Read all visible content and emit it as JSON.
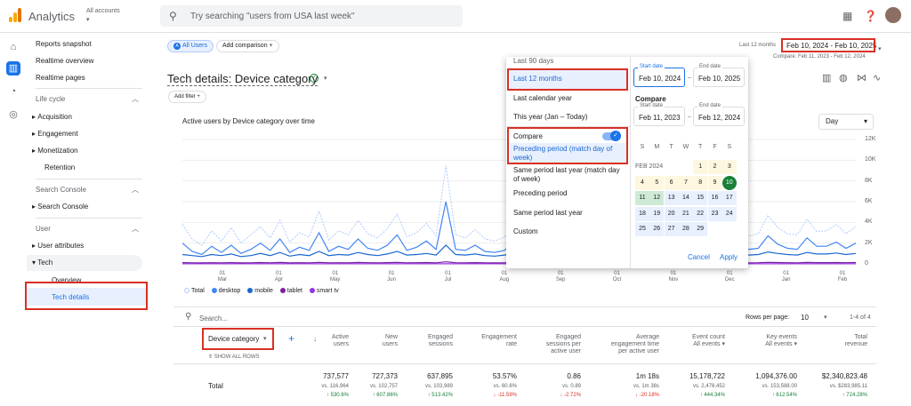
{
  "app": {
    "name": "Analytics",
    "account_label": "All accounts",
    "account_caret": "▾"
  },
  "search": {
    "placeholder": "Try searching \"users from USA last week\""
  },
  "nav": {
    "items": [
      "Reports snapshot",
      "Realtime overview",
      "Realtime pages"
    ],
    "lifecycle": "Life cycle",
    "lifecycle_items": [
      "Acquisition",
      "Engagement",
      "Monetization",
      "Retention"
    ],
    "search_console": "Search Console",
    "search_console_items": [
      "Search Console"
    ],
    "user": "User",
    "user_items": [
      "User attributes",
      "Tech"
    ],
    "tech_sub": [
      "Overview",
      "Tech details"
    ]
  },
  "comparison": {
    "all_users": "All Users",
    "all_users_badge": "A",
    "add_comparison": "Add comparison",
    "plus": "+"
  },
  "date": {
    "label": "Last 12 months",
    "range": "Feb 10, 2024 - Feb 10, 2025",
    "compare": "Compare: Feb 11, 2023 - Feb 12, 2024"
  },
  "page": {
    "title": "Tech details: Device category",
    "add_filter": "Add filter",
    "add_filter_plus": "+"
  },
  "chart_data": {
    "type": "line",
    "title": "Active users by Device category over time",
    "granularity": "Day",
    "y_ticks": [
      "12K",
      "10K",
      "8K",
      "6K",
      "4K",
      "2K",
      "0"
    ],
    "ylim": [
      0,
      12000
    ],
    "x_ticks": [
      [
        "01",
        "Mar"
      ],
      [
        "01",
        "Apr"
      ],
      [
        "01",
        "May"
      ],
      [
        "01",
        "Jun"
      ],
      [
        "01",
        "Jul"
      ],
      [
        "01",
        "Aug"
      ],
      [
        "01",
        "Sep"
      ],
      [
        "01",
        "Oct"
      ],
      [
        "01",
        "Nov"
      ],
      [
        "01",
        "Dec"
      ],
      [
        "01",
        "Jan"
      ],
      [
        "01",
        "Feb"
      ]
    ],
    "legend": [
      "Total",
      "desktop",
      "mobile",
      "tablet",
      "smart tv"
    ],
    "series": [
      {
        "name": "Total",
        "peak": 9500,
        "values": [
          3800,
          2400,
          1800,
          3200,
          2200,
          3500,
          2000,
          2800,
          3600,
          2500,
          4200,
          2100,
          3000,
          2600,
          5100,
          2300,
          3200,
          2800,
          4200,
          2900,
          2500,
          3400,
          4800,
          2600,
          3000,
          3900,
          2700,
          9500,
          2800,
          2500,
          3300,
          2400,
          2200,
          2600,
          3800,
          4500,
          3300,
          2900,
          4800,
          3400,
          3700,
          4100,
          2800,
          3400,
          5100,
          3800,
          3600,
          2900,
          4300,
          3100,
          2800,
          3400,
          2600,
          2500,
          2300,
          3000,
          2800,
          3600,
          2700,
          2900,
          4700,
          3500,
          2900,
          2800,
          4300,
          3100,
          3200,
          3800,
          2900,
          3600
        ]
      },
      {
        "name": "desktop",
        "values": [
          2000,
          1200,
          900,
          1700,
          1100,
          1800,
          1000,
          1400,
          2000,
          1300,
          2400,
          1100,
          1600,
          1300,
          3000,
          1200,
          1700,
          1400,
          2400,
          1500,
          1300,
          1800,
          2800,
          1300,
          1600,
          2200,
          1400,
          6000,
          1400,
          1300,
          1800,
          1200,
          1100,
          1300,
          2100,
          2600,
          1800,
          1500,
          2800,
          1800,
          2000,
          2300,
          1400,
          1800,
          3000,
          2100,
          1900,
          1500,
          2500,
          1700,
          1400,
          1800,
          1300,
          1300,
          1100,
          1600,
          1400,
          2000,
          1400,
          1500,
          2700,
          1900,
          1500,
          1400,
          2500,
          1700,
          1700,
          2100,
          1500,
          2000
        ]
      },
      {
        "name": "mobile",
        "values": [
          900,
          800,
          700,
          900,
          800,
          950,
          700,
          800,
          1000,
          800,
          1100,
          750,
          900,
          800,
          1200,
          800,
          900,
          850,
          1100,
          900,
          800,
          950,
          1200,
          850,
          900,
          1000,
          850,
          1800,
          900,
          850,
          950,
          800,
          750,
          850,
          1000,
          1200,
          950,
          900,
          1200,
          950,
          1000,
          1100,
          900,
          950,
          1250,
          1050,
          1000,
          900,
          1100,
          950,
          900,
          950,
          850,
          850,
          800,
          900,
          850,
          1000,
          850,
          900,
          1150,
          1000,
          900,
          850,
          1100,
          950,
          950,
          1050,
          900,
          1000
        ]
      },
      {
        "name": "tablet",
        "values": [
          120,
          100,
          90,
          110,
          100,
          120,
          90,
          100,
          130,
          100,
          140,
          95,
          110,
          100,
          150,
          100,
          110,
          105,
          140,
          110,
          100,
          120,
          150,
          105,
          110,
          130,
          105,
          200,
          110,
          105,
          120,
          100,
          95,
          105,
          130,
          150,
          120,
          110,
          150,
          120,
          125,
          135,
          110,
          120,
          155,
          130,
          125,
          110,
          140,
          120,
          110,
          120,
          105,
          105,
          100,
          110,
          105,
          125,
          105,
          110,
          145,
          125,
          110,
          105,
          140,
          120,
          120,
          130,
          110,
          125
        ]
      },
      {
        "name": "smart tv",
        "values": [
          10,
          10,
          10,
          10,
          10,
          10,
          10,
          10,
          10,
          10,
          10,
          10,
          10,
          10,
          10,
          10,
          10,
          10,
          10,
          10,
          10,
          10,
          10,
          10,
          10,
          10,
          10,
          10,
          10,
          10,
          10,
          10,
          10,
          10,
          10,
          10,
          10,
          10,
          10,
          10,
          10,
          10,
          10,
          10,
          10,
          10,
          10,
          10,
          10,
          10,
          10,
          10,
          10,
          10,
          10,
          10,
          10,
          10,
          10,
          10,
          10,
          10,
          10,
          10,
          10,
          10,
          10,
          10,
          10,
          10
        ]
      }
    ]
  },
  "table": {
    "search_placeholder": "Search...",
    "rows_per_page_label": "Rows per page:",
    "rows_per_page": "10",
    "pagination": "1-4 of 4",
    "dim_label": "Device category",
    "show_all_rows": "SHOW ALL ROWS",
    "total_label": "Total",
    "columns": [
      {
        "h": [
          "Active",
          "users"
        ],
        "v": "737,577",
        "vs": "vs. 116,964",
        "ch": "↑ 530.6%",
        "up": true
      },
      {
        "h": [
          "New",
          "users"
        ],
        "v": "727,373",
        "vs": "vs. 102,757",
        "ch": "↑ 607.86%",
        "up": true
      },
      {
        "h": [
          "Engaged",
          "sessions"
        ],
        "v": "637,895",
        "vs": "vs. 103,989",
        "ch": "↑ 513.42%",
        "up": true
      },
      {
        "h": [
          "Engagement",
          "rate"
        ],
        "v": "53.57%",
        "vs": "vs. 60.6%",
        "ch": "↓ -11.59%",
        "up": false
      },
      {
        "h": [
          "Engaged",
          "sessions per",
          "active user"
        ],
        "v": "0.86",
        "vs": "vs. 0.89",
        "ch": "↓ -2.72%",
        "up": false
      },
      {
        "h": [
          "Average",
          "engagement time",
          "per active user"
        ],
        "v": "1m 18s",
        "vs": "vs. 1m 38s",
        "ch": "↓ -20.18%",
        "up": false
      },
      {
        "h": [
          "Event count",
          "All events ▾"
        ],
        "v": "15,178,722",
        "vs": "vs. 2,478,452",
        "ch": "↑ 444.34%",
        "up": true
      },
      {
        "h": [
          "Key events",
          "All events ▾"
        ],
        "v": "1,094,376.00",
        "vs": "vs. 153,588.00",
        "ch": "↑ 612.54%",
        "up": true
      },
      {
        "h": [
          "Total",
          "revenue"
        ],
        "v": "$2,340,823.48",
        "vs": "vs. $283,985.11",
        "ch": "↑ 724.28%",
        "up": true
      }
    ]
  },
  "datepicker": {
    "options_top": "Last 90 days",
    "options": [
      "Last 12 months",
      "Last calendar year",
      "This year (Jan – Today)"
    ],
    "compare_label": "Compare",
    "compare_options": [
      "Preceding period (match day of week)",
      "Same period last year (match day of week)",
      "Preceding period",
      "Same period last year",
      "Custom"
    ],
    "start_label": "Start date",
    "end_label": "End date",
    "start": "Feb 10, 2024",
    "end": "Feb 10, 2025",
    "compare_heading": "Compare",
    "c_start": "Feb 11, 2023",
    "c_end": "Feb 12, 2024",
    "weekdays": [
      "S",
      "M",
      "T",
      "W",
      "T",
      "F",
      "S"
    ],
    "month": "FEB 2024",
    "cancel": "Cancel",
    "apply": "Apply"
  },
  "colors": {
    "accent": "#1a73e8",
    "red": "#d93025",
    "green": "#188038",
    "total": "#aecbfa",
    "desktop": "#4285f4",
    "mobile": "#1967d2",
    "tablet": "#7b1fa2",
    "smarttv": "#9334e6"
  }
}
